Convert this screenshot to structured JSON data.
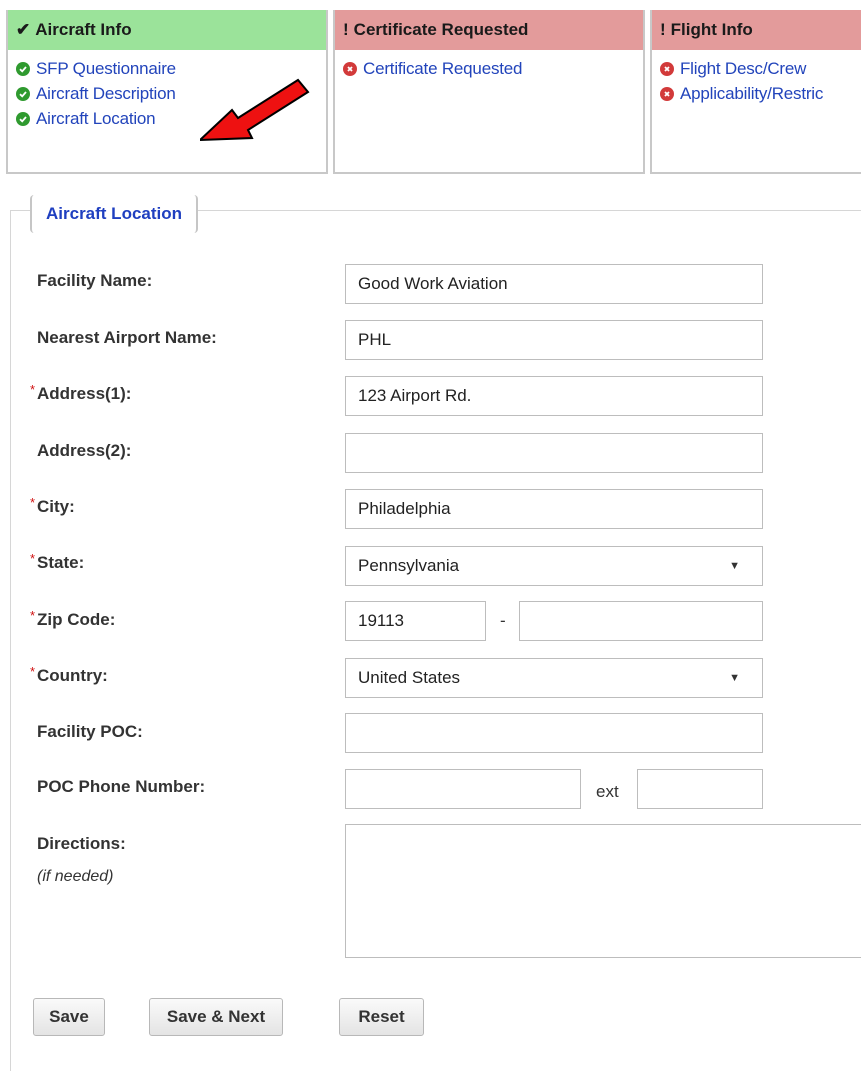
{
  "cards": [
    {
      "title": "Aircraft Info",
      "status": "ok",
      "items": [
        "SFP Questionnaire",
        "Aircraft Description",
        "Aircraft Location"
      ]
    },
    {
      "title": "Certificate Requested",
      "status": "bad",
      "items": [
        "Certificate Requested"
      ]
    },
    {
      "title": "Flight Info",
      "status": "bad",
      "items": [
        "Flight Desc/Crew",
        "Applicability/Restric"
      ]
    }
  ],
  "section_title": "Aircraft Location",
  "form": {
    "facility_name": {
      "label": "Facility Name:",
      "value": "Good Work Aviation"
    },
    "nearest_airport": {
      "label": "Nearest Airport Name:",
      "value": "PHL"
    },
    "address1": {
      "label": "Address(1):",
      "value": "123 Airport Rd."
    },
    "address2": {
      "label": "Address(2):",
      "value": ""
    },
    "city": {
      "label": "City:",
      "value": "Philadelphia"
    },
    "state": {
      "label": "State:",
      "value": "Pennsylvania"
    },
    "zip": {
      "label": "Zip Code:",
      "value": "19113",
      "ext_value": "",
      "separator": "-"
    },
    "country": {
      "label": "Country:",
      "value": "United States"
    },
    "facility_poc": {
      "label": "Facility POC:",
      "value": ""
    },
    "poc_phone": {
      "label": "POC Phone Number:",
      "value": "",
      "ext_label": "ext",
      "ext_value": ""
    },
    "directions": {
      "label": "Directions:",
      "hint": "(if needed)",
      "value": ""
    },
    "required_marker": "*"
  },
  "buttons": {
    "save": "Save",
    "save_next": "Save & Next",
    "reset": "Reset"
  },
  "colors": {
    "ok_header": "#9be39a",
    "bad_header": "#e39b9b",
    "link": "#2244bb",
    "legend": "#1f3fc0",
    "required": "#d01010",
    "arrow": "#ee1111"
  }
}
